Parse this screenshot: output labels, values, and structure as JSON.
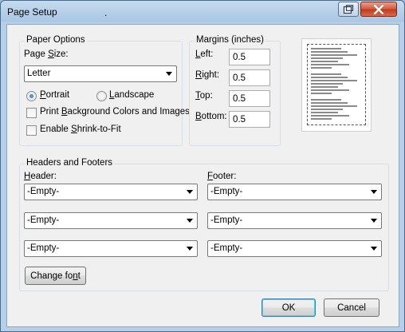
{
  "window": {
    "title": "Page Setup",
    "title_dot": "."
  },
  "paper_options": {
    "group_title": "Paper Options",
    "page_size_label_pre": "Page ",
    "page_size_label_u": "S",
    "page_size_label_post": "ize:",
    "page_size_value": "Letter",
    "portrait_pre": "",
    "portrait_u": "P",
    "portrait_post": "ortrait",
    "landscape_pre": "",
    "landscape_u": "L",
    "landscape_post": "andscape",
    "orientation_selected": "portrait",
    "print_bg_pre": "Print ",
    "print_bg_u": "B",
    "print_bg_post": "ackground Colors and Images",
    "print_bg_checked": false,
    "shrink_pre": "Enable ",
    "shrink_u": "S",
    "shrink_post": "hrink-to-Fit",
    "shrink_checked": false
  },
  "margins": {
    "group_title": "Margins (inches)",
    "left_u": "L",
    "left_post": "eft:",
    "left_value": "0.5",
    "right_u": "R",
    "right_post": "ight:",
    "right_value": "0.5",
    "top_u": "T",
    "top_post": "op:",
    "top_value": "0.5",
    "bottom_u": "B",
    "bottom_post": "ottom:",
    "bottom_value": "0.5"
  },
  "headers_footers": {
    "group_title": "Headers and Footers",
    "header_u": "H",
    "header_post": "eader:",
    "footer_u": "F",
    "footer_post": "ooter:",
    "header_values": [
      "-Empty-",
      "-Empty-",
      "-Empty-"
    ],
    "footer_values": [
      "-Empty-",
      "-Empty-",
      "-Empty-"
    ],
    "change_font_pre": "Change fo",
    "change_font_u": "n",
    "change_font_post": "t"
  },
  "buttons": {
    "ok": "OK",
    "cancel": "Cancel"
  },
  "icons": {
    "restore": "restore-icon",
    "close": "close-icon",
    "dropdown": "chevron-down-icon"
  },
  "colors": {
    "close_button": "#c0391c",
    "dialog_bg": "#f0f0f0",
    "title_bar": "#a9c6e3"
  }
}
